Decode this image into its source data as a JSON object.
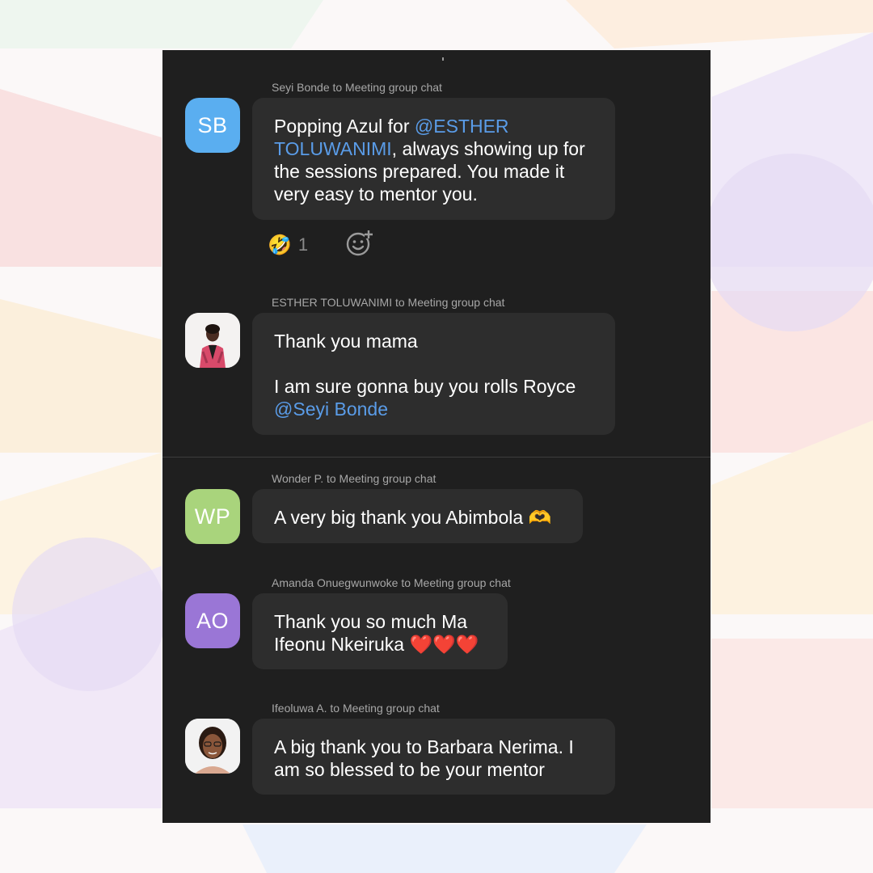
{
  "conversation": {
    "messages": [
      {
        "sender_line": "Seyi Bonde to Meeting group chat",
        "avatar_initials": "SB",
        "avatar_color": "#5aaef0",
        "text_before": "Popping Azul for ",
        "mention": "@ESTHER TOLUWANIMI",
        "text_after": ", always showing up for the sessions prepared. You made it very easy to mentor you.",
        "reaction": {
          "emoji": "🤣",
          "count": "1"
        }
      },
      {
        "sender_line": "ESTHER TOLUWANIMI to Meeting group chat",
        "avatar": "photo",
        "line1": "Thank you mama",
        "line2": "I am sure gonna buy you rolls Royce",
        "mention": "@Seyi Bonde"
      },
      {
        "sender_line": "Wonder P. to Meeting group chat",
        "avatar_initials": "WP",
        "avatar_color": "#a9d47c",
        "text": "A very big thank you Abimbola 🫶"
      },
      {
        "sender_line": "Amanda Onuegwunwoke to Meeting group chat",
        "avatar_initials": "AO",
        "avatar_color": "#9a76d6",
        "text": "Thank you so much Ma Ifeonu Nkeiruka ❤️❤️❤️"
      },
      {
        "sender_line": "Ifeoluwa A. to Meeting group chat",
        "avatar": "photo",
        "text": "A big thank you to Barbara Nerima. I am so blessed to be your mentor"
      }
    ]
  },
  "colors": {
    "screen_bg": "#1f1f1f",
    "bubble_bg": "#2d2d2d",
    "mention": "#5a9ce8"
  },
  "icons": [
    "add-reaction-icon",
    "rofl-emoji-icon"
  ]
}
